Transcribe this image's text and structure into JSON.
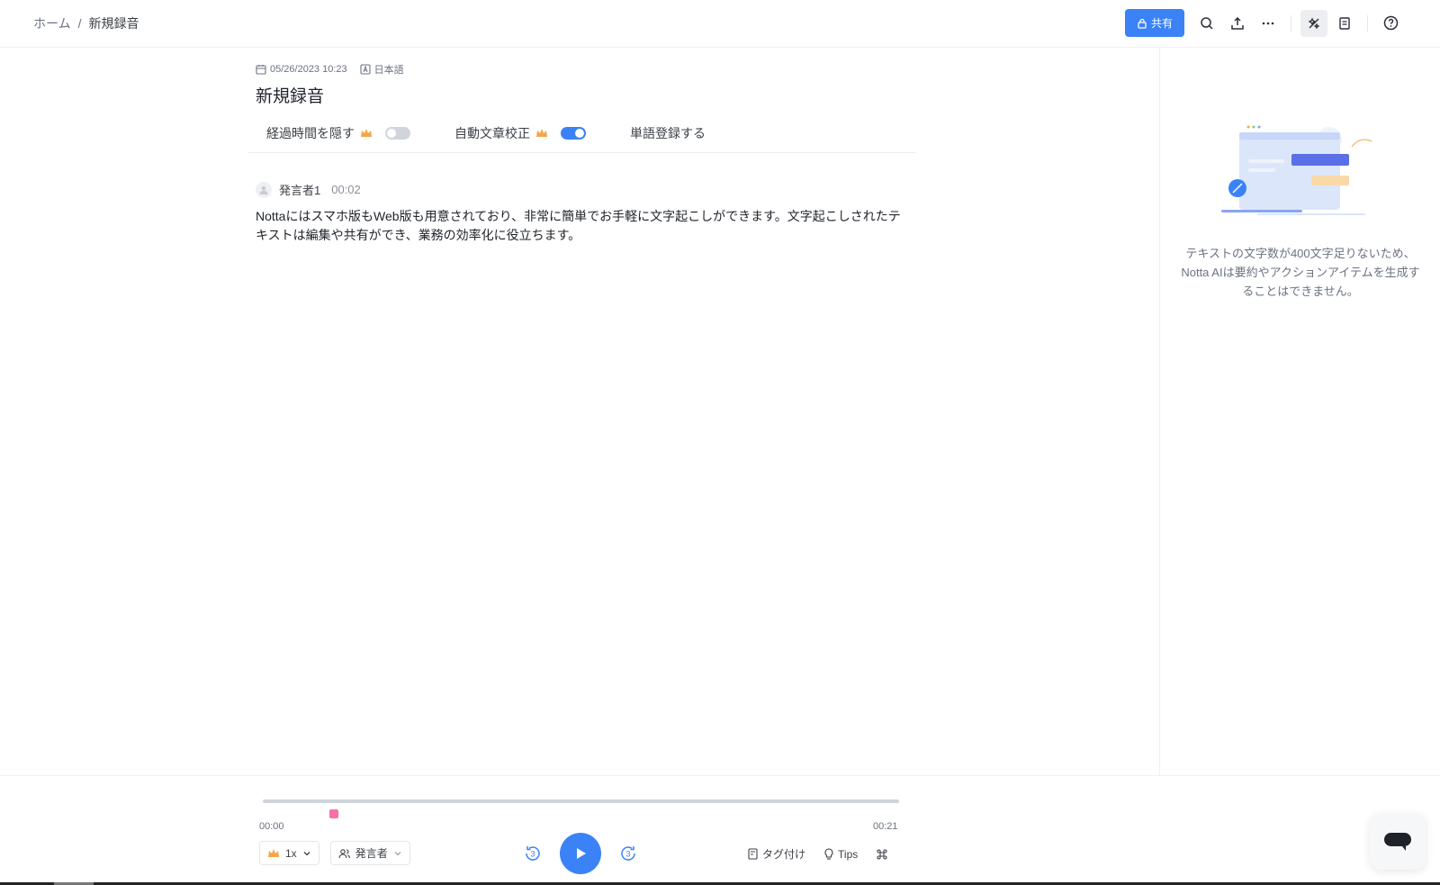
{
  "breadcrumb": {
    "home": "ホーム",
    "separator": "/",
    "current": "新規録音"
  },
  "toolbar": {
    "share_label": "共有",
    "icons": [
      "lock-icon",
      "search-icon",
      "export-icon",
      "more-icon",
      "ai-tools-icon",
      "notes-icon",
      "help-icon"
    ]
  },
  "meta": {
    "datetime": "05/26/2023 10:23",
    "language": "日本語"
  },
  "title": "新規録音",
  "options": {
    "hide_time_label": "経過時間を隠す",
    "hide_time_on": false,
    "auto_correct_label": "自動文章校正",
    "auto_correct_on": true,
    "register_words_label": "単語登録する"
  },
  "transcript": {
    "speaker": "発言者1",
    "time": "00:02",
    "text": "Nottaにはスマホ版もWeb版も用意されており、非常に簡単でお手軽に文字起こしができます。文字起こしされたテキストは編集や共有ができ、業務の効率化に役立ちます。"
  },
  "ai_panel": {
    "message": "テキストの文字数が400文字足りないため、Notta AIは要約やアクションアイテムを生成することはできません。"
  },
  "player": {
    "time_start": "00:00",
    "time_end": "00:21",
    "speed": "1x",
    "speaker_filter": "発言者",
    "skip_back": "3",
    "skip_forward": "3",
    "tag_label": "タグ付け",
    "tips_label": "Tips"
  },
  "colors": {
    "accent": "#3b82f6",
    "marker": "#f472a6",
    "crown": "#f5a54a"
  }
}
